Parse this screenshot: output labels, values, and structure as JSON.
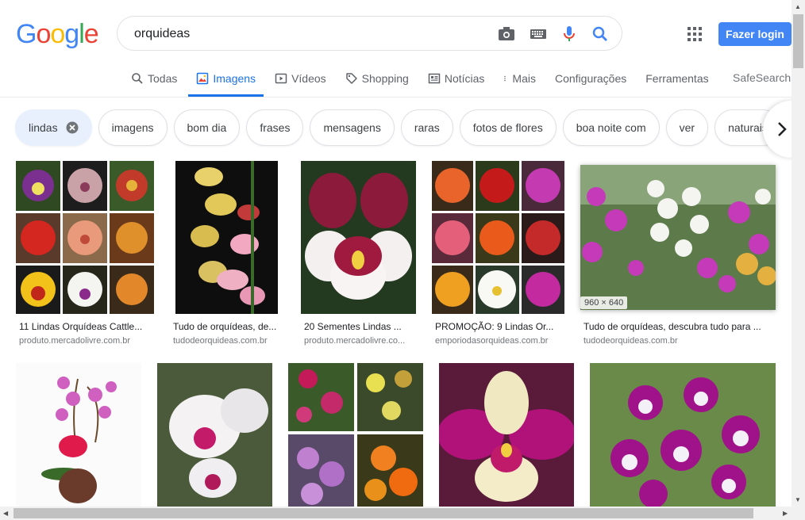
{
  "logo_letters": [
    "G",
    "o",
    "o",
    "g",
    "l",
    "e"
  ],
  "logo_colors": [
    "#4285f4",
    "#ea4335",
    "#fbbc05",
    "#4285f4",
    "#34a853",
    "#ea4335"
  ],
  "search": {
    "value": "orquideas"
  },
  "header": {
    "login_label": "Fazer login",
    "safesearch": "SafeSearch"
  },
  "tabs": [
    {
      "label": "Todas",
      "icon": "search-icon"
    },
    {
      "label": "Imagens",
      "icon": "image-icon",
      "active": true
    },
    {
      "label": "Vídeos",
      "icon": "play-icon"
    },
    {
      "label": "Shopping",
      "icon": "tag-icon"
    },
    {
      "label": "Notícias",
      "icon": "news-icon"
    },
    {
      "label": "Mais",
      "icon": "more-vert-icon"
    },
    {
      "label": "Configurações"
    },
    {
      "label": "Ferramentas"
    }
  ],
  "chips": [
    "lindas",
    "imagens",
    "bom dia",
    "frases",
    "mensagens",
    "raras",
    "fotos de flores",
    "boa noite com",
    "ver",
    "naturais"
  ],
  "results": [
    {
      "caption": "11 Lindas Orquídeas Cattle...",
      "source": "produto.mercadolivre.com.br"
    },
    {
      "caption": "Tudo de orquídeas, de...",
      "source": "tudodeorquideas.com.br"
    },
    {
      "caption": "20 Sementes Lindas ...",
      "source": "produto.mercadolivre.co..."
    },
    {
      "caption": "PROMOÇÃO: 9 Lindas Or...",
      "source": "emporiodasorquideas.com.br"
    },
    {
      "caption": "Tudo de orquídeas, descubra tudo para ...",
      "source": "tudodeorquideas.com.br",
      "dimensions": "960 × 640"
    }
  ]
}
